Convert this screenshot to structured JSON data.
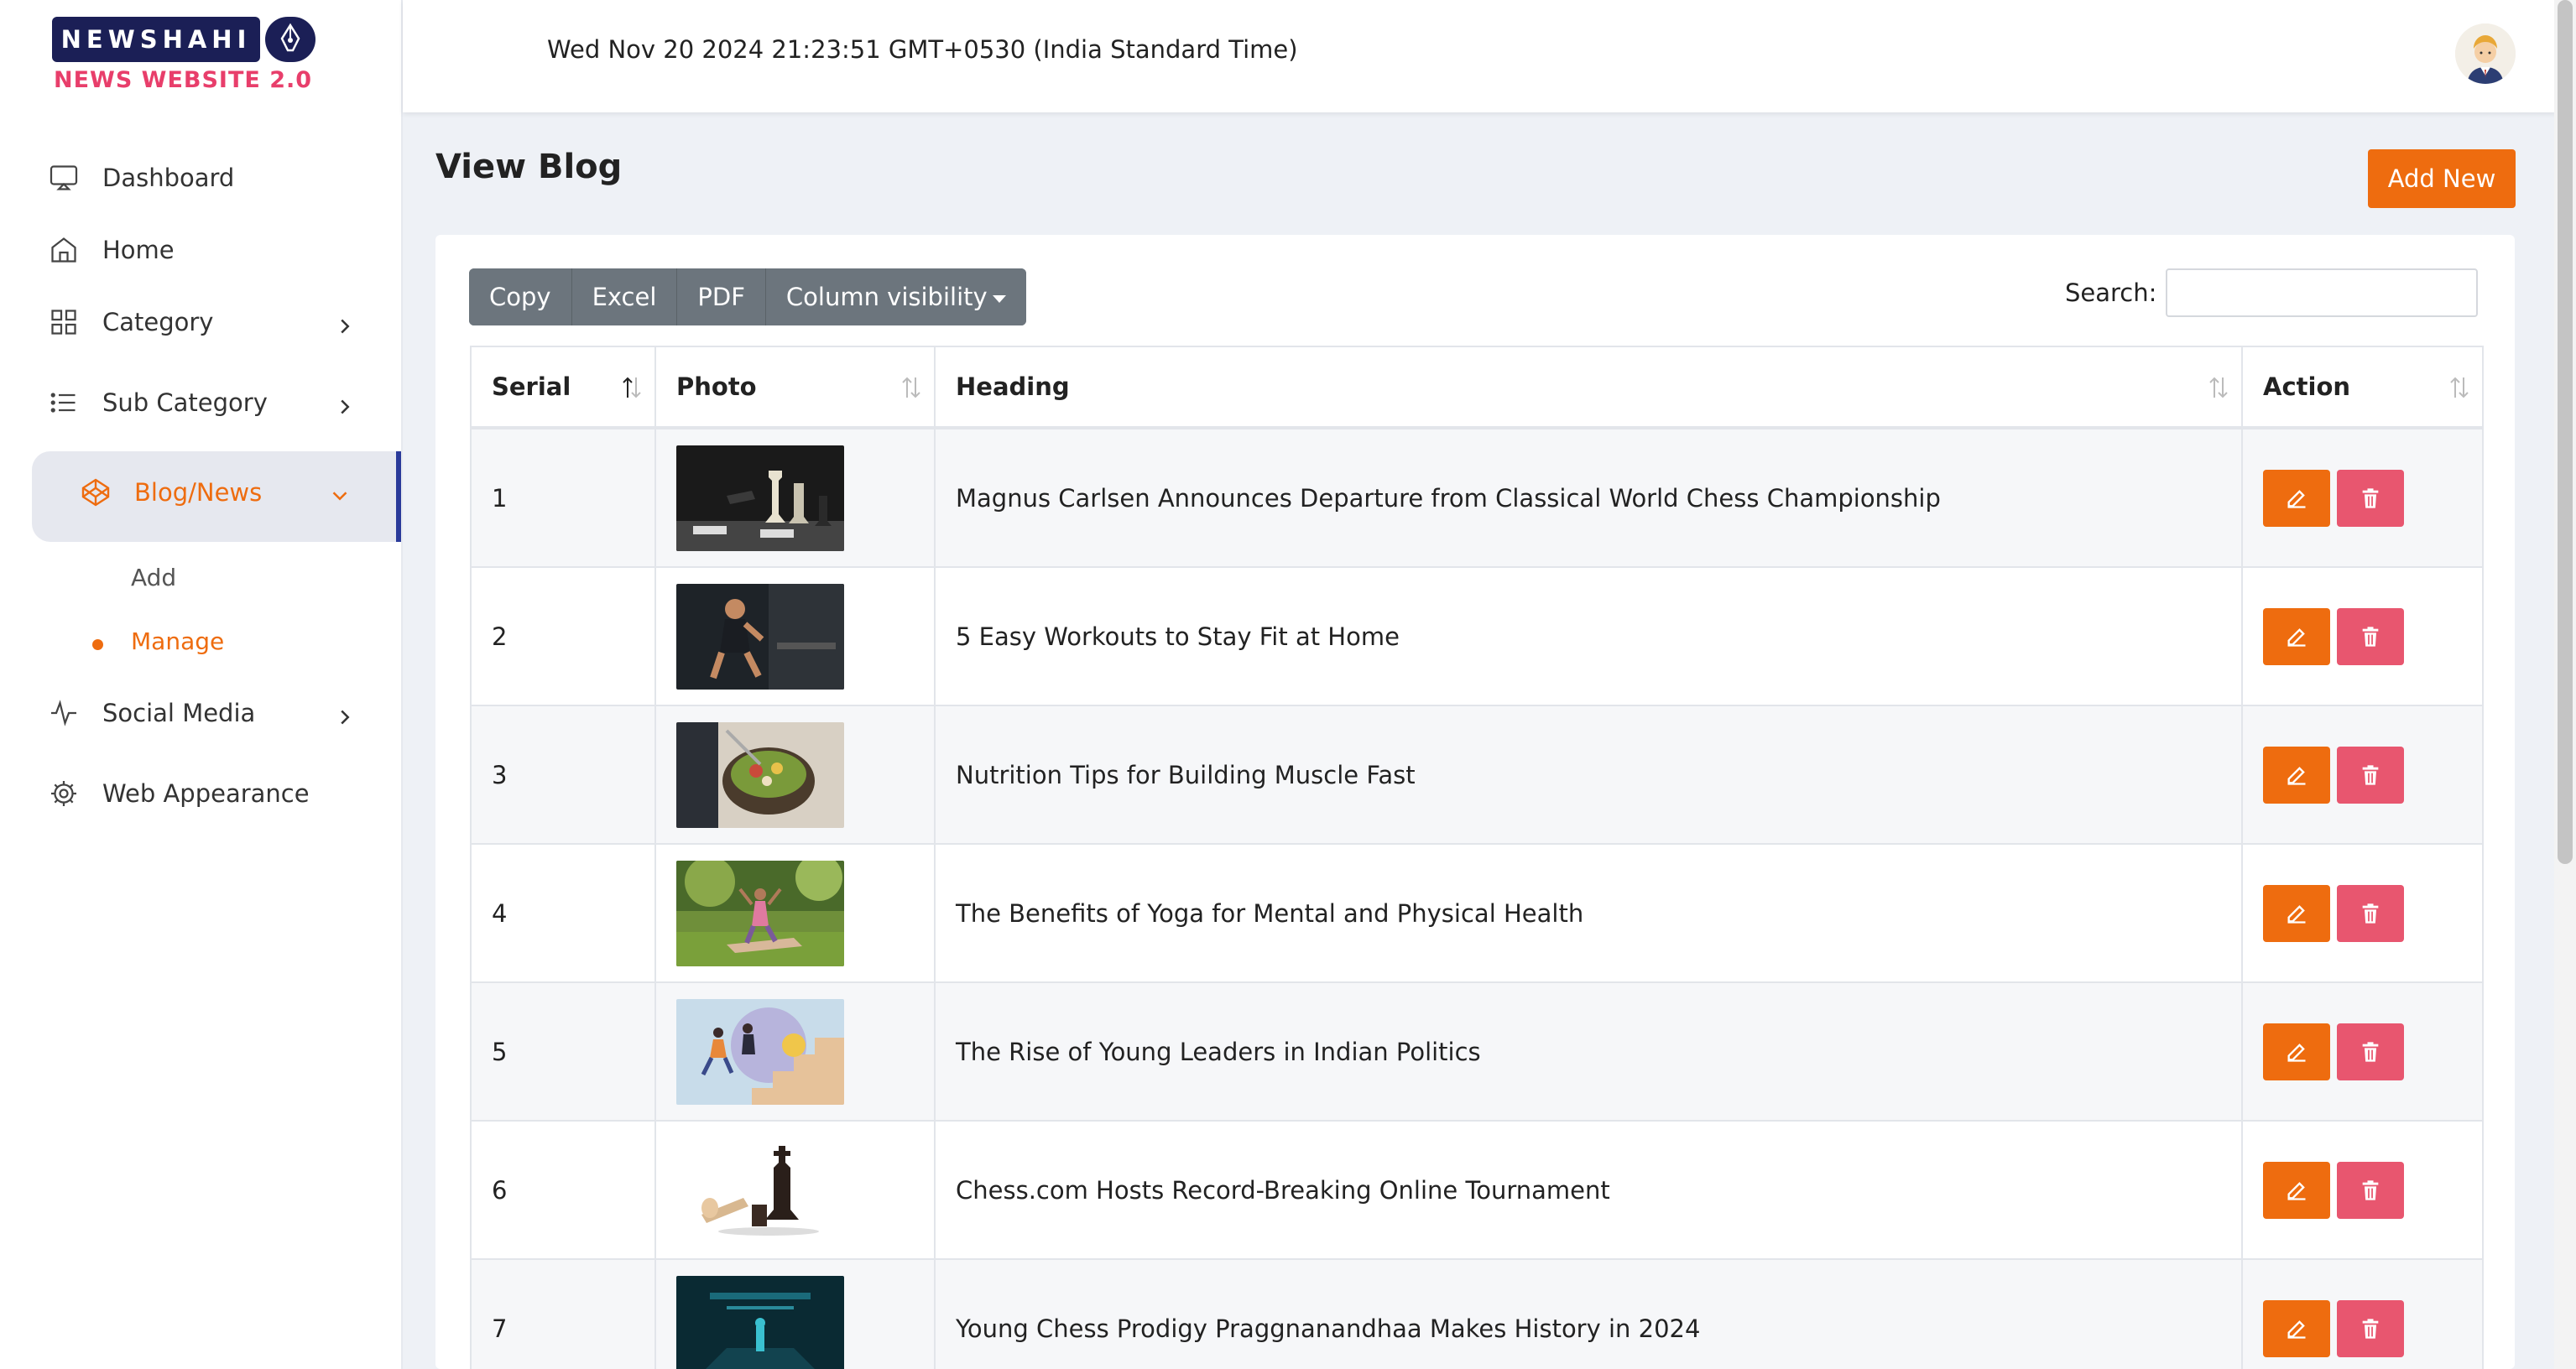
{
  "brand": {
    "name": "NEWSHAHI",
    "subtitle": "NEWS WEBSITE 2.0"
  },
  "header": {
    "datetime": "Wed Nov 20 2024 21:23:51 GMT+0530 (India Standard Time)"
  },
  "sidebar": {
    "items": [
      {
        "label": "Dashboard",
        "icon": "monitor-icon"
      },
      {
        "label": "Home",
        "icon": "home-icon"
      },
      {
        "label": "Category",
        "icon": "grid-icon"
      },
      {
        "label": "Sub Category",
        "icon": "list-icon"
      },
      {
        "label": "Blog/News",
        "icon": "codepen-icon"
      },
      {
        "label": "Social Media",
        "icon": "activity-icon"
      },
      {
        "label": "Web Appearance",
        "icon": "gear-icon"
      }
    ],
    "blog_sub": [
      {
        "label": "Add"
      },
      {
        "label": "Manage"
      }
    ]
  },
  "page": {
    "title": "View Blog",
    "add_new": "Add New"
  },
  "toolbar": {
    "copy": "Copy",
    "excel": "Excel",
    "pdf": "PDF",
    "column_visibility": "Column visibility"
  },
  "search": {
    "label": "Search:"
  },
  "table": {
    "columns": [
      "Serial",
      "Photo",
      "Heading",
      "Action"
    ],
    "rows": [
      {
        "serial": "1",
        "photo": "chess-pieces-photo",
        "heading": "Magnus Carlsen Announces Departure from Classical World Chess Championship"
      },
      {
        "serial": "2",
        "photo": "treadmill-runner-photo",
        "heading": "5 Easy Workouts to Stay Fit at Home"
      },
      {
        "serial": "3",
        "photo": "salad-bowl-photo",
        "heading": "Nutrition Tips for Building Muscle Fast"
      },
      {
        "serial": "4",
        "photo": "yoga-park-photo",
        "heading": "The Benefits of Yoga for Mental and Physical Health"
      },
      {
        "serial": "5",
        "photo": "leaders-stairs-illustration",
        "heading": "The Rise of Young Leaders in Indian Politics"
      },
      {
        "serial": "6",
        "photo": "fallen-king-chess-photo",
        "heading": "Chess.com Hosts Record-Breaking Online Tournament"
      },
      {
        "serial": "7",
        "photo": "digital-chess-photo",
        "heading": "Young Chess Prodigy Praggnanandhaa Makes History in 2024"
      }
    ]
  },
  "colors": {
    "accent": "#ee6c0f",
    "danger": "#e8566f",
    "active_bar": "#2a3a9a",
    "brand_dark": "#1b1f56"
  }
}
